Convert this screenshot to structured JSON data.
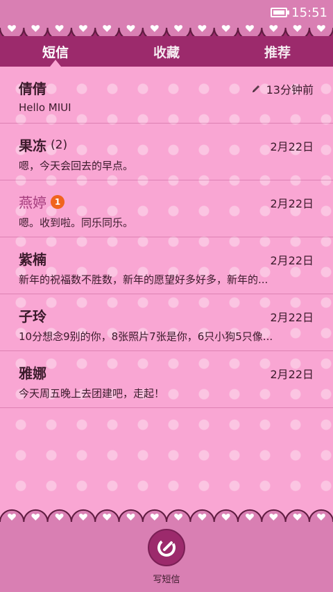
{
  "status_bar": {
    "time": "15:51"
  },
  "tabs": [
    {
      "label": "短信",
      "active": true
    },
    {
      "label": "收藏",
      "active": false
    },
    {
      "label": "推荐",
      "active": false
    }
  ],
  "conversations": [
    {
      "name": "倩倩",
      "count": "",
      "unread_badge": "",
      "date": "13分钟前",
      "draft": true,
      "preview": "Hello MIUI"
    },
    {
      "name": "果冻",
      "count": "(2)",
      "unread_badge": "",
      "date": "2月22日",
      "draft": false,
      "preview": "嗯，今天会回去的早点。"
    },
    {
      "name": "燕婷",
      "count": "",
      "unread_badge": "1",
      "date": "2月22日",
      "draft": false,
      "preview": "嗯。收到啦。同乐同乐。"
    },
    {
      "name": "紫楠",
      "count": "",
      "unread_badge": "",
      "date": "2月22日",
      "draft": false,
      "preview": "新年的祝福数不胜数，新年的愿望好多好多，新年的..."
    },
    {
      "name": "子玲",
      "count": "",
      "unread_badge": "",
      "date": "2月22日",
      "draft": false,
      "preview": "10分想念9别的你，8张照片7张是你，6只小狗5只像..."
    },
    {
      "name": "雅娜",
      "count": "",
      "unread_badge": "",
      "date": "2月22日",
      "draft": false,
      "preview": "今天周五晚上去团建吧，走起！"
    }
  ],
  "footer": {
    "compose_label": "写短信"
  },
  "colors": {
    "tab_bar": "#9c2a6c",
    "list_bg": "#f9a6d3",
    "badge": "#f0641e",
    "chrome": "#d97fb3"
  }
}
